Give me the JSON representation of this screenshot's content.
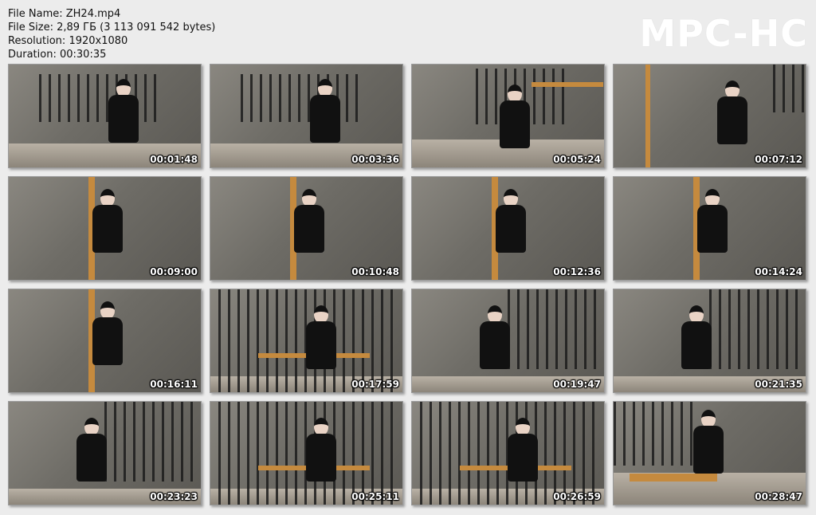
{
  "file_info": {
    "name": "File Name: ZH24.mp4",
    "size": "File Size: 2,89 ГБ (3 113 091 542 bytes)",
    "resolution": "Resolution: 1920x1080",
    "duration": "Duration: 00:30:35"
  },
  "logo": "MPC-HC",
  "thumbnails": [
    {
      "time": "00:01:48",
      "scene": "cell"
    },
    {
      "time": "00:03:36",
      "scene": "cell"
    },
    {
      "time": "00:05:24",
      "scene": "stocks"
    },
    {
      "time": "00:07:12",
      "scene": "wall"
    },
    {
      "time": "00:09:00",
      "scene": "cross"
    },
    {
      "time": "00:10:48",
      "scene": "cross"
    },
    {
      "time": "00:12:36",
      "scene": "cross"
    },
    {
      "time": "00:14:24",
      "scene": "cross"
    },
    {
      "time": "00:16:11",
      "scene": "cross"
    },
    {
      "time": "00:17:59",
      "scene": "bars"
    },
    {
      "time": "00:19:47",
      "scene": "chair"
    },
    {
      "time": "00:21:35",
      "scene": "chair"
    },
    {
      "time": "00:23:23",
      "scene": "chair"
    },
    {
      "time": "00:25:11",
      "scene": "bars"
    },
    {
      "time": "00:26:59",
      "scene": "bars"
    },
    {
      "time": "00:28:47",
      "scene": "bench"
    }
  ]
}
